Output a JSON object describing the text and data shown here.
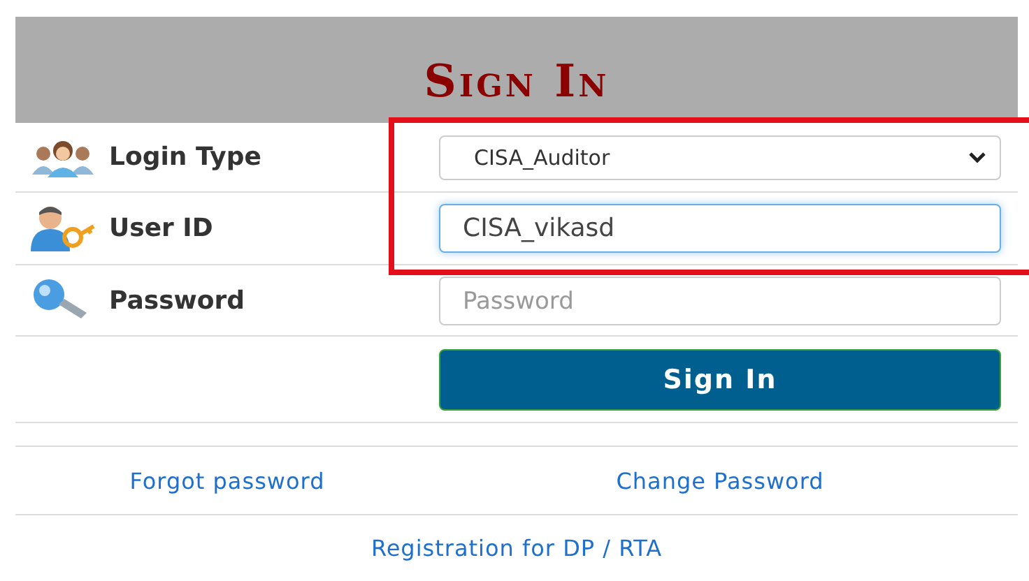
{
  "title": "Sign In",
  "fields": [
    {
      "kind": "select",
      "label": "Login Type",
      "value": "CISA_Auditor",
      "focused": false
    },
    {
      "kind": "text",
      "label": "User ID",
      "value": "CISA_vikasd",
      "focused": true
    },
    {
      "kind": "password",
      "label": "Password",
      "placeholder": "Password",
      "focused": false
    }
  ],
  "submit": "Sign In",
  "links": [
    "Forgot password",
    "Change Password"
  ],
  "footer_link": "Registration for DP / RTA"
}
